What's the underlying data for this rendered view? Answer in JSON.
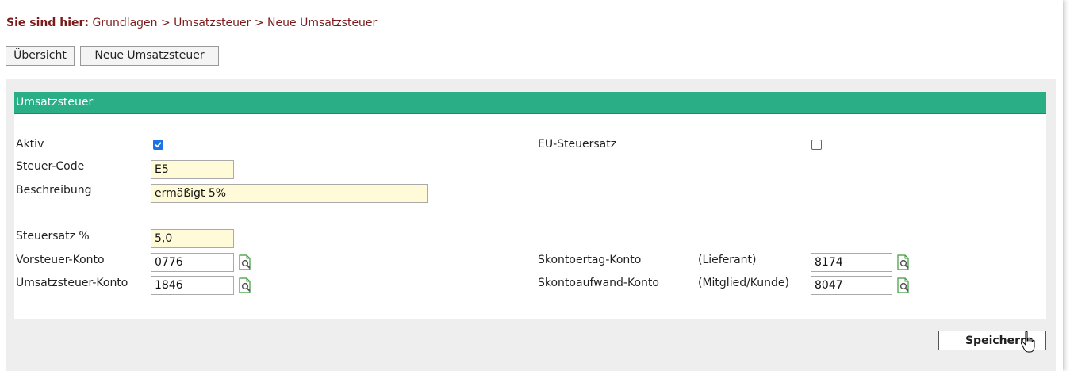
{
  "breadcrumb": {
    "lead": "Sie sind hier:",
    "path": "Grundlagen > Umsatzsteuer > Neue Umsatzsteuer"
  },
  "toolbar": {
    "overview_label": "Übersicht",
    "new_label": "Neue Umsatzsteuer"
  },
  "section": {
    "title": "Umsatzsteuer"
  },
  "form": {
    "aktiv_label": "Aktiv",
    "aktiv_checked": true,
    "eu_label": "EU-Steuersatz",
    "eu_checked": false,
    "code_label": "Steuer-Code",
    "code_value": "E5",
    "desc_label": "Beschreibung",
    "desc_value": "ermäßigt 5%",
    "rate_label": "Steuersatz %",
    "rate_value": "5,0",
    "vorsteuer_label": "Vorsteuer-Konto",
    "vorsteuer_value": "0776",
    "umsatz_label": "Umsatzsteuer-Konto",
    "umsatz_value": "1846",
    "skontoertrag_label": "Skontoertag-Konto",
    "skontoertrag_sub": "(Lieferant)",
    "skontoertrag_value": "8174",
    "skontoaufwand_label": "Skontoaufwand-Konto",
    "skontoaufwand_sub": "(Mitglied/Kunde)",
    "skontoaufwand_value": "8047"
  },
  "actions": {
    "save_label": "Speichern"
  },
  "colors": {
    "header": "#2aae85",
    "breadcrumb": "#7a1a1a",
    "input_highlight": "#fffbd9",
    "checkbox": "#1a73e8"
  },
  "icons": {
    "lookup": "document-search-icon",
    "cursor": "mouse-pointer-icon"
  }
}
